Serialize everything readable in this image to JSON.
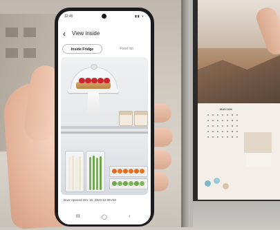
{
  "phone": {
    "status_time": "12:45",
    "status_icons": "▮▮ ◗",
    "back_symbol": "‹",
    "title": "View inside",
    "tabs": [
      {
        "label": "Inside Fridge",
        "selected": true
      },
      {
        "label": "Food list",
        "selected": false
      }
    ],
    "door_opened": "Door opened Dec 15, 2020 12:00 AM",
    "nav": {
      "recents": "III",
      "home": "◯",
      "back": "‹"
    }
  },
  "display": {
    "calendar_month": "MAY/JAN"
  },
  "colors": {
    "accent_berry": "#c9262e",
    "carrot": "#e46b1d",
    "greens": "#6ea74a"
  }
}
